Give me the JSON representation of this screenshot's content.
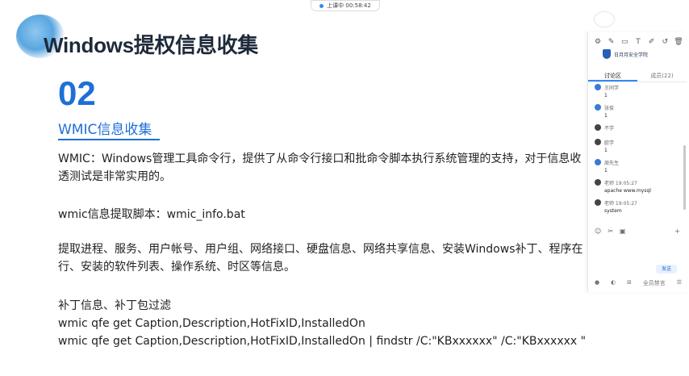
{
  "recording": {
    "time": "上课中 00:58:42"
  },
  "slide": {
    "title": "Windows提权信息收集",
    "section_number": "02",
    "section_title": "WMIC信息收集",
    "paragraphs": [
      "WMIC：Windows管理工具命令行，提供了从命令行接口和批命令脚本执行系统管理的支持，对于信息收",
      "透测试是非常实用的。",
      "wmic信息提取脚本：wmic_info.bat",
      "提取进程、服务、用户帐号、用户组、网络接口、硬盘信息、网络共享信息、安装Windows补丁、程序在",
      "行、安装的软件列表、操作系统、时区等信息。",
      "补丁信息、补丁包过滤",
      "wmic qfe get Caption,Description,HotFixID,InstalledOn",
      "wmic qfe get Caption,Description,HotFixID,InstalledOn | findstr /C:\"KBxxxxxx\" /C:\"KBxxxxxx \""
    ]
  },
  "panel": {
    "tools": [
      "⚙",
      "✎",
      "▭",
      "T",
      "✐",
      "↺",
      "🗑"
    ],
    "logo_text": "日月月安全学院",
    "tabs": [
      "讨论区",
      "成员(22)"
    ],
    "messages": [
      {
        "name": "王同学",
        "text": "1"
      },
      {
        "name": "张俊",
        "text": "1"
      },
      {
        "name": "不学",
        "text": ""
      },
      {
        "name": "欧学",
        "text": "1"
      },
      {
        "name": "周先生",
        "text": "1"
      },
      {
        "name": "老师 19:05:27",
        "text": "apache www.mysql"
      },
      {
        "name": "老师 19:05:27",
        "text": "system"
      }
    ],
    "icons": [
      "☺",
      "✂",
      "▣"
    ],
    "add_icon": "+",
    "send_label": "发送",
    "footer": [
      "●",
      "◐",
      "⊞",
      "全员禁言",
      "☰"
    ]
  }
}
